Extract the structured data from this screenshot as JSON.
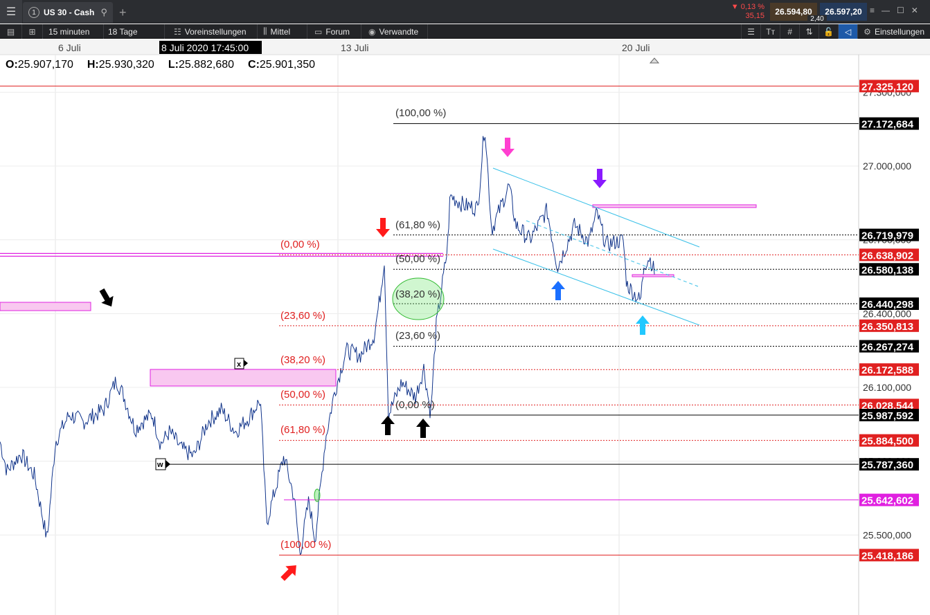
{
  "window": {
    "tab_label": "US 30 - Cash",
    "tab_number": "1",
    "change_percent": "▼ 0,13 %",
    "change_points": "35,15",
    "bid": "26.594,80",
    "ask": "26.597,20",
    "spread": "2,40"
  },
  "toolbar": {
    "interval": "15 minuten",
    "range": "18 Tage",
    "presets": "Voreinstellungen",
    "indicator": "Mittel",
    "forum": "Forum",
    "related": "Verwandte",
    "settings": "Einstellungen"
  },
  "chart": {
    "dates": [
      "6 Juli",
      "13 Juli",
      "20 Juli"
    ],
    "crosshair_date": "8 Juli 2020 17:45:00",
    "ohlc": {
      "o_label": "O:",
      "o": "25.907,170",
      "h_label": "H:",
      "h": "25.930,320",
      "l_label": "L:",
      "l": "25.882,680",
      "c_label": "C:",
      "c": "25.901,350"
    },
    "axis_ticks": [
      "27.300,000",
      "27.000,000",
      "26.700,000",
      "26.400,000",
      "26.100,000",
      "25.800,000",
      "25.500,000"
    ],
    "price_tags": [
      {
        "value": "27.325,120",
        "color": "#e02020"
      },
      {
        "value": "27.172,684",
        "color": "#000000"
      },
      {
        "value": "26.719,979",
        "color": "#000000"
      },
      {
        "value": "26.638,902",
        "color": "#e02020"
      },
      {
        "value": "26.580,138",
        "color": "#000000"
      },
      {
        "value": "26.440,298",
        "color": "#000000"
      },
      {
        "value": "26.350,813",
        "color": "#e02020"
      },
      {
        "value": "26.267,274",
        "color": "#000000"
      },
      {
        "value": "26.172,588",
        "color": "#e02020"
      },
      {
        "value": "26.028,544",
        "color": "#e02020"
      },
      {
        "value": "25.987,592",
        "color": "#000000"
      },
      {
        "value": "25.884,500",
        "color": "#e02020"
      },
      {
        "value": "25.787,360",
        "color": "#000000"
      },
      {
        "value": "25.642,602",
        "color": "#e020e0"
      },
      {
        "value": "25.418,186",
        "color": "#e02020"
      }
    ],
    "fib_red": [
      "(0,00 %)",
      "(23,60 %)",
      "(38,20 %)",
      "(50,00 %)",
      "(61,80 %)",
      "(100,00 %)"
    ],
    "fib_black": [
      "(100,00 %)",
      "(61,80 %)",
      "(50,00 %)",
      "(38,20 %)",
      "(23,60 %)",
      "(0,00 %)"
    ],
    "markers": {
      "x": "x",
      "w": "w"
    }
  },
  "colors": {
    "accent_red": "#e02020",
    "magenta": "#e020e0",
    "channel": "#38c0e8",
    "series": "#1a4fd0"
  }
}
